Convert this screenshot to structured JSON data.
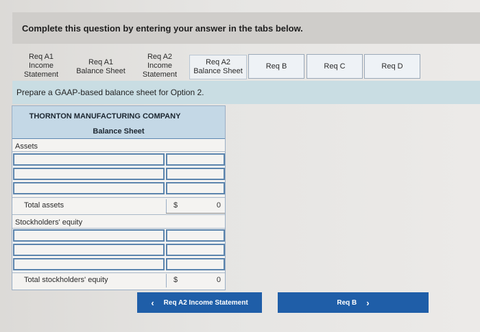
{
  "instruction": "Complete this question by entering your answer in the tabs below.",
  "tabs": [
    {
      "id": "req-a1-income",
      "label": "Req A1\nIncome\nStatement"
    },
    {
      "id": "req-a1-balance",
      "label": "Req A1\nBalance Sheet"
    },
    {
      "id": "req-a2-income",
      "label": "Req A2\nIncome\nStatement"
    },
    {
      "id": "req-a2-balance",
      "label": "Req A2\nBalance Sheet",
      "active": true
    },
    {
      "id": "req-b",
      "label": "Req B"
    },
    {
      "id": "req-c",
      "label": "Req C"
    },
    {
      "id": "req-d",
      "label": "Req D"
    }
  ],
  "prompt": "Prepare a GAAP-based balance sheet for Option 2.",
  "sheet": {
    "company": "THORNTON MANUFACTURING COMPANY",
    "title": "Balance Sheet",
    "assets_label": "Assets",
    "total_assets_label": "Total assets",
    "total_assets_currency": "$",
    "total_assets_value": "0",
    "equity_label": "Stockholders' equity",
    "total_equity_label": "Total stockholders' equity",
    "total_equity_currency": "$",
    "total_equity_value": "0"
  },
  "nav": {
    "prev_label": "Req A2 Income Statement",
    "next_label": "Req B"
  },
  "colors": {
    "accent": "#1f5ea8",
    "header_fill": "#c4d8e6",
    "band": "#c9dde3"
  }
}
